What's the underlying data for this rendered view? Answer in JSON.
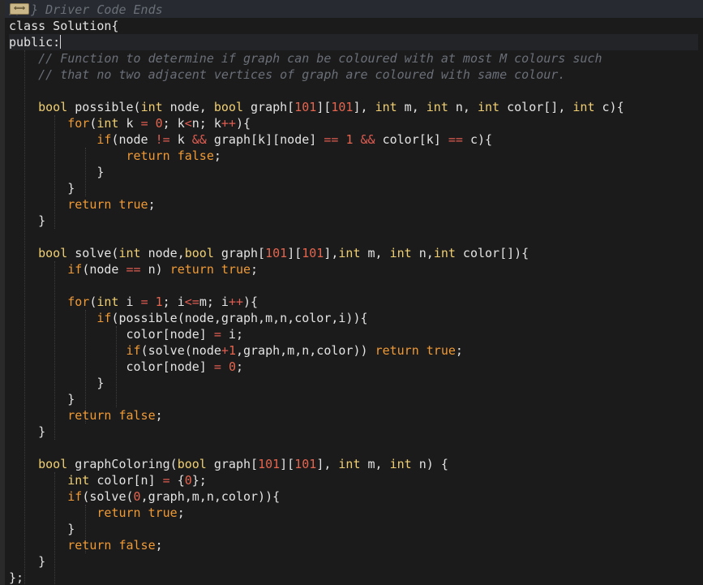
{
  "editor": {
    "fold_marker_icon": "fold-arrows-icon",
    "lines": [
      {
        "tokens": [
          {
            "t": "cm",
            "v": "// } Driver Code Ends"
          }
        ]
      },
      {
        "tokens": [
          {
            "t": "tx",
            "v": "class Solution{"
          }
        ]
      },
      {
        "tokens": [
          {
            "t": "tx",
            "v": "public:"
          }
        ],
        "current": true
      },
      {
        "tokens": [
          {
            "t": "tx",
            "v": "    "
          },
          {
            "t": "cm",
            "v": "// Function to determine if graph can be coloured with at most M colours such"
          }
        ]
      },
      {
        "tokens": [
          {
            "t": "tx",
            "v": "    "
          },
          {
            "t": "cm",
            "v": "// that no two adjacent vertices of graph are coloured with same colour."
          }
        ]
      },
      {
        "tokens": []
      },
      {
        "tokens": [
          {
            "t": "tx",
            "v": "    "
          },
          {
            "t": "ty",
            "v": "bool"
          },
          {
            "t": "tx",
            "v": " possible("
          },
          {
            "t": "ty",
            "v": "int"
          },
          {
            "t": "tx",
            "v": " node, "
          },
          {
            "t": "ty",
            "v": "bool"
          },
          {
            "t": "tx",
            "v": " graph["
          },
          {
            "t": "num",
            "v": "101"
          },
          {
            "t": "tx",
            "v": "]["
          },
          {
            "t": "num",
            "v": "101"
          },
          {
            "t": "tx",
            "v": "], "
          },
          {
            "t": "ty",
            "v": "int"
          },
          {
            "t": "tx",
            "v": " m, "
          },
          {
            "t": "ty",
            "v": "int"
          },
          {
            "t": "tx",
            "v": " n, "
          },
          {
            "t": "ty",
            "v": "int"
          },
          {
            "t": "tx",
            "v": " color[], "
          },
          {
            "t": "ty",
            "v": "int"
          },
          {
            "t": "tx",
            "v": " c){"
          }
        ]
      },
      {
        "tokens": [
          {
            "t": "tx",
            "v": "        "
          },
          {
            "t": "kw",
            "v": "for"
          },
          {
            "t": "tx",
            "v": "("
          },
          {
            "t": "ty",
            "v": "int"
          },
          {
            "t": "tx",
            "v": " k "
          },
          {
            "t": "op",
            "v": "="
          },
          {
            "t": "tx",
            "v": " "
          },
          {
            "t": "num",
            "v": "0"
          },
          {
            "t": "tx",
            "v": "; k"
          },
          {
            "t": "op",
            "v": "<"
          },
          {
            "t": "tx",
            "v": "n; k"
          },
          {
            "t": "op",
            "v": "++"
          },
          {
            "t": "tx",
            "v": "){"
          }
        ]
      },
      {
        "tokens": [
          {
            "t": "tx",
            "v": "            "
          },
          {
            "t": "kw",
            "v": "if"
          },
          {
            "t": "tx",
            "v": "(node "
          },
          {
            "t": "op",
            "v": "!="
          },
          {
            "t": "tx",
            "v": " k "
          },
          {
            "t": "op",
            "v": "&&"
          },
          {
            "t": "tx",
            "v": " graph[k][node] "
          },
          {
            "t": "op",
            "v": "=="
          },
          {
            "t": "tx",
            "v": " "
          },
          {
            "t": "num",
            "v": "1"
          },
          {
            "t": "tx",
            "v": " "
          },
          {
            "t": "op",
            "v": "&&"
          },
          {
            "t": "tx",
            "v": " color[k] "
          },
          {
            "t": "op",
            "v": "=="
          },
          {
            "t": "tx",
            "v": " c){"
          }
        ]
      },
      {
        "tokens": [
          {
            "t": "tx",
            "v": "                "
          },
          {
            "t": "kw",
            "v": "return"
          },
          {
            "t": "tx",
            "v": " "
          },
          {
            "t": "kw",
            "v": "false"
          },
          {
            "t": "tx",
            "v": ";"
          }
        ]
      },
      {
        "tokens": [
          {
            "t": "tx",
            "v": "            }"
          }
        ]
      },
      {
        "tokens": [
          {
            "t": "tx",
            "v": "        }"
          }
        ]
      },
      {
        "tokens": [
          {
            "t": "tx",
            "v": "        "
          },
          {
            "t": "kw",
            "v": "return"
          },
          {
            "t": "tx",
            "v": " "
          },
          {
            "t": "kw",
            "v": "true"
          },
          {
            "t": "tx",
            "v": ";"
          }
        ]
      },
      {
        "tokens": [
          {
            "t": "tx",
            "v": "    }"
          }
        ]
      },
      {
        "tokens": []
      },
      {
        "tokens": [
          {
            "t": "tx",
            "v": "    "
          },
          {
            "t": "ty",
            "v": "bool"
          },
          {
            "t": "tx",
            "v": " solve("
          },
          {
            "t": "ty",
            "v": "int"
          },
          {
            "t": "tx",
            "v": " node,"
          },
          {
            "t": "ty",
            "v": "bool"
          },
          {
            "t": "tx",
            "v": " graph["
          },
          {
            "t": "num",
            "v": "101"
          },
          {
            "t": "tx",
            "v": "]["
          },
          {
            "t": "num",
            "v": "101"
          },
          {
            "t": "tx",
            "v": "],"
          },
          {
            "t": "ty",
            "v": "int"
          },
          {
            "t": "tx",
            "v": " m, "
          },
          {
            "t": "ty",
            "v": "int"
          },
          {
            "t": "tx",
            "v": " n,"
          },
          {
            "t": "ty",
            "v": "int"
          },
          {
            "t": "tx",
            "v": " color[]){"
          }
        ]
      },
      {
        "tokens": [
          {
            "t": "tx",
            "v": "        "
          },
          {
            "t": "kw",
            "v": "if"
          },
          {
            "t": "tx",
            "v": "(node "
          },
          {
            "t": "op",
            "v": "=="
          },
          {
            "t": "tx",
            "v": " n) "
          },
          {
            "t": "kw",
            "v": "return"
          },
          {
            "t": "tx",
            "v": " "
          },
          {
            "t": "kw",
            "v": "true"
          },
          {
            "t": "tx",
            "v": ";"
          }
        ]
      },
      {
        "tokens": []
      },
      {
        "tokens": [
          {
            "t": "tx",
            "v": "        "
          },
          {
            "t": "kw",
            "v": "for"
          },
          {
            "t": "tx",
            "v": "("
          },
          {
            "t": "ty",
            "v": "int"
          },
          {
            "t": "tx",
            "v": " i "
          },
          {
            "t": "op",
            "v": "="
          },
          {
            "t": "tx",
            "v": " "
          },
          {
            "t": "num",
            "v": "1"
          },
          {
            "t": "tx",
            "v": "; i"
          },
          {
            "t": "op",
            "v": "<="
          },
          {
            "t": "tx",
            "v": "m; i"
          },
          {
            "t": "op",
            "v": "++"
          },
          {
            "t": "tx",
            "v": "){"
          }
        ]
      },
      {
        "tokens": [
          {
            "t": "tx",
            "v": "            "
          },
          {
            "t": "kw",
            "v": "if"
          },
          {
            "t": "tx",
            "v": "(possible(node,graph,m,n,color,i)){"
          }
        ]
      },
      {
        "tokens": [
          {
            "t": "tx",
            "v": "                color[node] "
          },
          {
            "t": "op",
            "v": "="
          },
          {
            "t": "tx",
            "v": " i;"
          }
        ]
      },
      {
        "tokens": [
          {
            "t": "tx",
            "v": "                "
          },
          {
            "t": "kw",
            "v": "if"
          },
          {
            "t": "tx",
            "v": "(solve(node"
          },
          {
            "t": "op",
            "v": "+"
          },
          {
            "t": "num",
            "v": "1"
          },
          {
            "t": "tx",
            "v": ",graph,m,n,color)) "
          },
          {
            "t": "kw",
            "v": "return"
          },
          {
            "t": "tx",
            "v": " "
          },
          {
            "t": "kw",
            "v": "true"
          },
          {
            "t": "tx",
            "v": ";"
          }
        ]
      },
      {
        "tokens": [
          {
            "t": "tx",
            "v": "                color[node] "
          },
          {
            "t": "op",
            "v": "="
          },
          {
            "t": "tx",
            "v": " "
          },
          {
            "t": "num",
            "v": "0"
          },
          {
            "t": "tx",
            "v": ";"
          }
        ]
      },
      {
        "tokens": [
          {
            "t": "tx",
            "v": "            }"
          }
        ]
      },
      {
        "tokens": [
          {
            "t": "tx",
            "v": "        }"
          }
        ]
      },
      {
        "tokens": [
          {
            "t": "tx",
            "v": "        "
          },
          {
            "t": "kw",
            "v": "return"
          },
          {
            "t": "tx",
            "v": " "
          },
          {
            "t": "kw",
            "v": "false"
          },
          {
            "t": "tx",
            "v": ";"
          }
        ]
      },
      {
        "tokens": [
          {
            "t": "tx",
            "v": "    }"
          }
        ]
      },
      {
        "tokens": []
      },
      {
        "tokens": [
          {
            "t": "tx",
            "v": "    "
          },
          {
            "t": "ty",
            "v": "bool"
          },
          {
            "t": "tx",
            "v": " graphColoring("
          },
          {
            "t": "ty",
            "v": "bool"
          },
          {
            "t": "tx",
            "v": " graph["
          },
          {
            "t": "num",
            "v": "101"
          },
          {
            "t": "tx",
            "v": "]["
          },
          {
            "t": "num",
            "v": "101"
          },
          {
            "t": "tx",
            "v": "], "
          },
          {
            "t": "ty",
            "v": "int"
          },
          {
            "t": "tx",
            "v": " m, "
          },
          {
            "t": "ty",
            "v": "int"
          },
          {
            "t": "tx",
            "v": " n) {"
          }
        ]
      },
      {
        "tokens": [
          {
            "t": "tx",
            "v": "        "
          },
          {
            "t": "ty",
            "v": "int"
          },
          {
            "t": "tx",
            "v": " color[n] "
          },
          {
            "t": "op",
            "v": "="
          },
          {
            "t": "tx",
            "v": " {"
          },
          {
            "t": "num",
            "v": "0"
          },
          {
            "t": "tx",
            "v": "};"
          }
        ]
      },
      {
        "tokens": [
          {
            "t": "tx",
            "v": "        "
          },
          {
            "t": "kw",
            "v": "if"
          },
          {
            "t": "tx",
            "v": "(solve("
          },
          {
            "t": "num",
            "v": "0"
          },
          {
            "t": "tx",
            "v": ",graph,m,n,color)){"
          }
        ]
      },
      {
        "tokens": [
          {
            "t": "tx",
            "v": "            "
          },
          {
            "t": "kw",
            "v": "return"
          },
          {
            "t": "tx",
            "v": " "
          },
          {
            "t": "kw",
            "v": "true"
          },
          {
            "t": "tx",
            "v": ";"
          }
        ]
      },
      {
        "tokens": [
          {
            "t": "tx",
            "v": "        }"
          }
        ]
      },
      {
        "tokens": [
          {
            "t": "tx",
            "v": "        "
          },
          {
            "t": "kw",
            "v": "return"
          },
          {
            "t": "tx",
            "v": " "
          },
          {
            "t": "kw",
            "v": "false"
          },
          {
            "t": "tx",
            "v": ";"
          }
        ]
      },
      {
        "tokens": [
          {
            "t": "tx",
            "v": "    }"
          }
        ]
      },
      {
        "tokens": [
          {
            "t": "tx",
            "v": "};"
          }
        ]
      }
    ]
  }
}
